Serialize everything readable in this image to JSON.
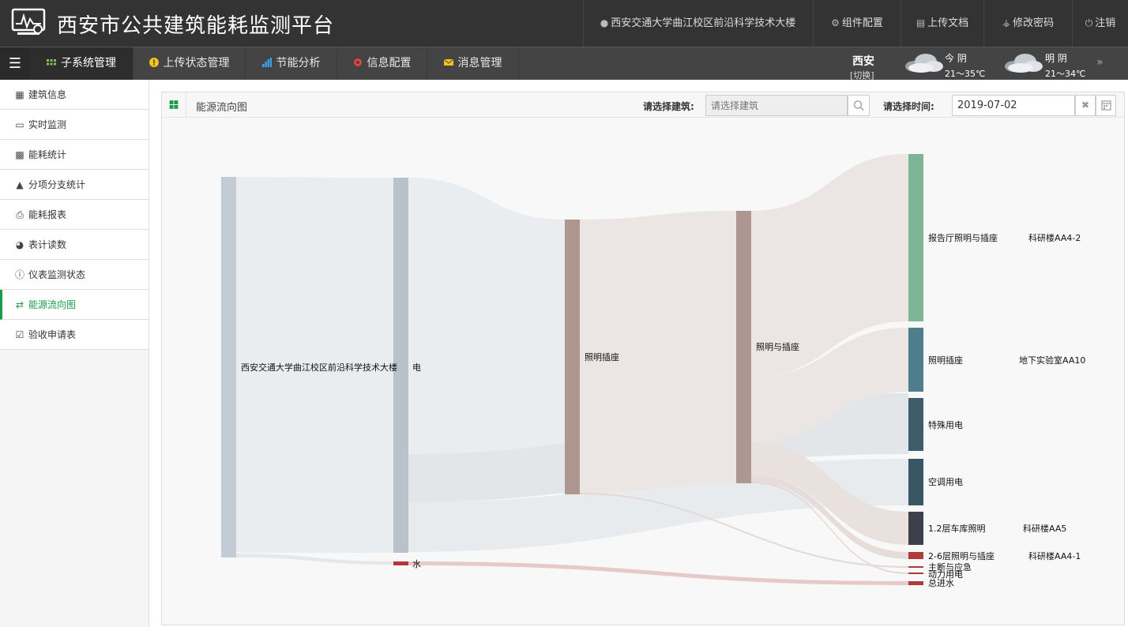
{
  "header": {
    "title": "西安市公共建筑能耗监测平台",
    "building": "西安交通大学曲江校区前沿科学技术大楼",
    "widget_config": "组件配置",
    "upload_doc": "上传文档",
    "change_password": "修改密码",
    "logout": "注销"
  },
  "nav": {
    "tabs": [
      {
        "label": "子系统管理",
        "icon": "grid-icon",
        "color": "#7dc35b"
      },
      {
        "label": "上传状态管理",
        "icon": "info-icon",
        "color": "#f0c419"
      },
      {
        "label": "节能分析",
        "icon": "bar-chart-icon",
        "color": "#3aa0e8"
      },
      {
        "label": "信息配置",
        "icon": "gear-icon",
        "color": "#e8443a"
      },
      {
        "label": "消息管理",
        "icon": "mail-icon",
        "color": "#f0c419"
      }
    ]
  },
  "weather": {
    "city": "西安",
    "switch": "[切换]",
    "today_label": "今 阴",
    "today_temp": "21～35℃",
    "tomorrow_label": "明 阴",
    "tomorrow_temp": "21～34℃"
  },
  "sidebar": {
    "items": [
      {
        "label": "建筑信息",
        "icon": "building-icon"
      },
      {
        "label": "实时监测",
        "icon": "laptop-icon"
      },
      {
        "label": "能耗统计",
        "icon": "bar-chart-icon"
      },
      {
        "label": "分项分支统计",
        "icon": "sitemap-icon"
      },
      {
        "label": "能耗报表",
        "icon": "print-icon"
      },
      {
        "label": "表计读数",
        "icon": "dashboard-icon"
      },
      {
        "label": "仪表监测状态",
        "icon": "info-icon"
      },
      {
        "label": "能源流向图",
        "icon": "shuffle-icon"
      },
      {
        "label": "验收申请表",
        "icon": "checkbox-icon"
      }
    ]
  },
  "panel": {
    "title": "能源流向图",
    "building_label": "请选择建筑:",
    "building_placeholder": "请选择建筑",
    "date_label": "请选择时间:",
    "date_value": "2019-07-02"
  },
  "chart_data": {
    "type": "sankey",
    "nodes": [
      {
        "id": "root",
        "label": "西安交通大学曲江校区前沿科学技术大楼",
        "color": "#c3ccd4"
      },
      {
        "id": "elec",
        "label": "电",
        "color": "#b9c2ca"
      },
      {
        "id": "water",
        "label": "水",
        "color": "#b03a3a"
      },
      {
        "id": "light1",
        "label": "照明插座",
        "color": "#ae9790"
      },
      {
        "id": "light2",
        "label": "照明与插座",
        "color": "#ae9790"
      },
      {
        "id": "t1",
        "label": "报告厅照明与插座",
        "sub": "科研楼AA4-2",
        "color": "#7fb597"
      },
      {
        "id": "t2",
        "label": "照明插座",
        "sub": "地下实验室AA10",
        "color": "#4e7d8c"
      },
      {
        "id": "t3",
        "label": "特殊用电",
        "sub": "",
        "color": "#3d5d6a"
      },
      {
        "id": "t4",
        "label": "空调用电",
        "sub": "",
        "color": "#3a5563"
      },
      {
        "id": "t5",
        "label": "1.2层车库照明",
        "sub": "科研楼AA5",
        "color": "#3d3f4a"
      },
      {
        "id": "t6",
        "label": "2-6层照明与插座",
        "sub": "科研楼AA4-1",
        "color": "#b03a3a"
      },
      {
        "id": "t7",
        "label": "主断与应急",
        "sub": "",
        "color": "#b03a3a"
      },
      {
        "id": "t8",
        "label": "动力用电",
        "sub": "",
        "color": "#b03a3a"
      },
      {
        "id": "t9",
        "label": "总进水",
        "sub": "",
        "color": "#b03a3a"
      }
    ]
  }
}
